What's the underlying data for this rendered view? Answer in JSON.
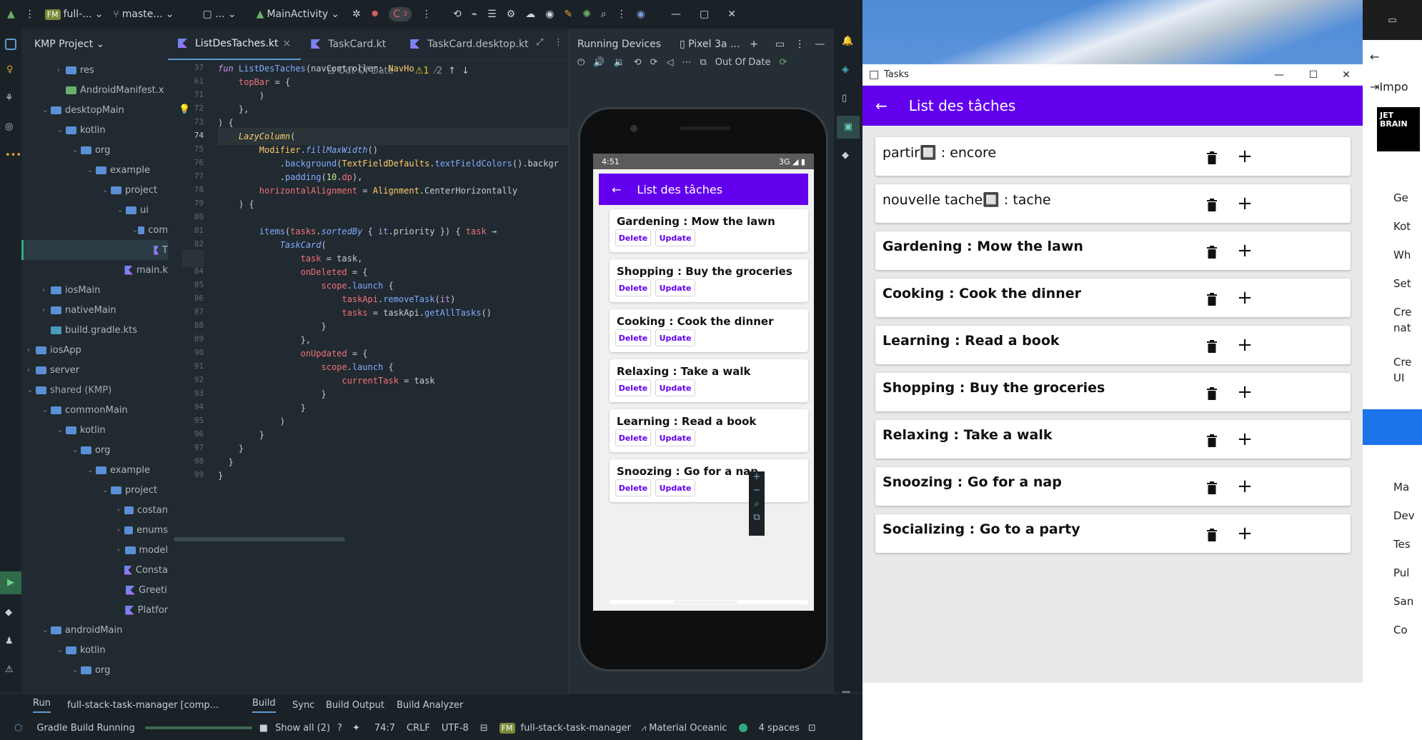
{
  "ide": {
    "project_badge": "FM",
    "project_name": "full-...",
    "branch": "maste...",
    "run_config": "MainActivity",
    "run_count": "3",
    "project_panel_title": "KMP Project",
    "tree": [
      {
        "label": "res",
        "type": "folder",
        "indent": 2,
        "arrow": "›"
      },
      {
        "label": "AndroidManifest.x",
        "type": "android",
        "indent": 2,
        "arrow": ""
      },
      {
        "label": "desktopMain",
        "type": "folder",
        "indent": 1,
        "arrow": "⌄"
      },
      {
        "label": "kotlin",
        "type": "folder",
        "indent": 2,
        "arrow": "⌄"
      },
      {
        "label": "org",
        "type": "folder",
        "indent": 3,
        "arrow": "⌄"
      },
      {
        "label": "example",
        "type": "folder",
        "indent": 4,
        "arrow": "⌄"
      },
      {
        "label": "project",
        "type": "folder",
        "indent": 5,
        "arrow": "⌄"
      },
      {
        "label": "ui",
        "type": "folder",
        "indent": 6,
        "arrow": "⌄"
      },
      {
        "label": "com",
        "type": "folder",
        "indent": 7,
        "arrow": "⌄"
      },
      {
        "label": "T",
        "type": "kotlin",
        "indent": 8,
        "arrow": "",
        "selected": true
      },
      {
        "label": "main.k",
        "type": "kotlin",
        "indent": 6,
        "arrow": ""
      },
      {
        "label": "iosMain",
        "type": "folder",
        "indent": 1,
        "arrow": "›"
      },
      {
        "label": "nativeMain",
        "type": "folder",
        "indent": 1,
        "arrow": "›"
      },
      {
        "label": "build.gradle.kts",
        "type": "gradle",
        "indent": 1,
        "arrow": ""
      },
      {
        "label": "iosApp",
        "type": "folder",
        "indent": 0,
        "arrow": "›"
      },
      {
        "label": "server",
        "type": "folder",
        "indent": 0,
        "arrow": "›"
      },
      {
        "label": "shared (KMP)",
        "type": "folder",
        "indent": 0,
        "arrow": "⌄"
      },
      {
        "label": "commonMain",
        "type": "folder",
        "indent": 1,
        "arrow": "⌄"
      },
      {
        "label": "kotlin",
        "type": "folder",
        "indent": 2,
        "arrow": "⌄"
      },
      {
        "label": "org",
        "type": "folder",
        "indent": 3,
        "arrow": "⌄"
      },
      {
        "label": "example",
        "type": "folder",
        "indent": 4,
        "arrow": "⌄"
      },
      {
        "label": "project",
        "type": "folder",
        "indent": 5,
        "arrow": "⌄"
      },
      {
        "label": "costan",
        "type": "folder",
        "indent": 6,
        "arrow": "›"
      },
      {
        "label": "enums",
        "type": "folder",
        "indent": 6,
        "arrow": "›"
      },
      {
        "label": "model",
        "type": "folder",
        "indent": 6,
        "arrow": "›"
      },
      {
        "label": "Consta",
        "type": "kotlin",
        "indent": 6,
        "arrow": ""
      },
      {
        "label": "Greeti",
        "type": "kotlin",
        "indent": 6,
        "arrow": ""
      },
      {
        "label": "Platfor",
        "type": "kotlin",
        "indent": 6,
        "arrow": ""
      },
      {
        "label": "androidMain",
        "type": "folder",
        "indent": 1,
        "arrow": "⌄"
      },
      {
        "label": "kotlin",
        "type": "folder",
        "indent": 2,
        "arrow": "⌄"
      },
      {
        "label": "org",
        "type": "folder",
        "indent": 3,
        "arrow": "⌄"
      }
    ],
    "tabs": [
      {
        "label": "ListDesTaches.kt",
        "active": true,
        "close": "×"
      },
      {
        "label": "TaskCard.kt",
        "active": false,
        "close": ""
      },
      {
        "label": "TaskCard.desktop.kt",
        "active": false,
        "close": ""
      }
    ],
    "breadcrumb": "fun ListDesTaches(navController: NavHos",
    "out_of_date": "Out Of Date",
    "warnings": "1",
    "weak_warnings": "2",
    "code_lines": [
      {
        "n": "37",
        "html": "<span class='kw it2'>fun </span><span class='fn'>ListDesTaches</span><span class='pl'>(navController: </span><span class='ty'>NavHo</span>"
      },
      {
        "n": "61",
        "html": "    <span class='pr'>topBar</span><span class='pl'> = {</span>"
      },
      {
        "n": "71",
        "html": "        <span class='pl'>)</span>"
      },
      {
        "n": "72",
        "html": "    <span class='pl'>},</span>"
      },
      {
        "n": "73",
        "html": "<span class='pl'>) {</span>"
      },
      {
        "n": "74",
        "html": "    <span class='ty it2'>LazyColumn</span><span class='pl'>(</span>"
      },
      {
        "n": "75",
        "html": "        <span class='ty'>Modifier</span><span class='pl'>.</span><span class='fn it2'>fillMaxWidth</span><span class='pl'>()</span>"
      },
      {
        "n": "76",
        "html": "            <span class='pl'>.</span><span class='fn'>background</span><span class='pl'>(</span><span class='ty'>TextFieldDefaults</span><span class='pl'>.</span><span class='fn'>textFieldColors</span><span class='pl'>().backgr</span>"
      },
      {
        "n": "77",
        "html": "            <span class='pl'>.</span><span class='fn'>padding</span><span class='pl'>(</span><span class='st'>10</span><span class='pl'>.</span><span class='pr'>dp</span><span class='pl'>),</span>"
      },
      {
        "n": "78",
        "html": "        <span class='pr'>horizontalAlignment</span><span class='pl'> = </span><span class='ty'>Alignment</span><span class='pl'>.CenterHorizontally</span>"
      },
      {
        "n": "79",
        "html": "    <span class='pl'>) {</span>"
      },
      {
        "n": "80",
        "html": ""
      },
      {
        "n": "81",
        "html": "        <span class='fn'>items</span><span class='pl'>(</span><span class='pr'>tasks</span><span class='pl'>.</span><span class='fn it2'>sortedBy</span><span class='pl'> { </span><span class='kw'>it</span><span class='pl'>.priority }) { </span><span class='pr'>task</span><span class='pl'> →</span>"
      },
      {
        "n": "82",
        "html": "            <span class='fn it2'>TaskCard</span><span class='pl'>(</span>"
      },
      {
        "n": "83",
        "html": "                <span class='pr'>task</span><span class='pl'> = task,</span>"
      },
      {
        "n": "84",
        "html": "                <span class='pr'>onDeleted</span><span class='pl'> = {</span>"
      },
      {
        "n": "85",
        "html": "                    <span class='pr'>scope</span><span class='pl'>.</span><span class='fn'>launch</span><span class='pl'> {</span>"
      },
      {
        "n": "86",
        "html": "                        <span class='pr'>taskApi</span><span class='pl'>.</span><span class='fn'>removeTask</span><span class='pl'>(</span><span class='kw'>it</span><span class='pl'>)</span>"
      },
      {
        "n": "87",
        "html": "                        <span class='pr'>tasks</span><span class='pl'> = taskApi.</span><span class='fn'>getAllTasks</span><span class='pl'>()</span>"
      },
      {
        "n": "88",
        "html": "                    <span class='pl'>}</span>"
      },
      {
        "n": "89",
        "html": "                <span class='pl'>},</span>"
      },
      {
        "n": "90",
        "html": "                <span class='pr'>onUpdated</span><span class='pl'> = {</span>"
      },
      {
        "n": "91",
        "html": "                    <span class='pr'>scope</span><span class='pl'>.</span><span class='fn'>launch</span><span class='pl'> {</span>"
      },
      {
        "n": "92",
        "html": "                        <span class='pr'>currentTask</span><span class='pl'> = task</span>"
      },
      {
        "n": "93",
        "html": "                    <span class='pl'>}</span>"
      },
      {
        "n": "94",
        "html": "                <span class='pl'>}</span>"
      },
      {
        "n": "95",
        "html": "            <span class='pl'>)</span>"
      },
      {
        "n": "96",
        "html": "        <span class='pl'>}</span>"
      },
      {
        "n": "97",
        "html": "    <span class='pl'>}</span>"
      },
      {
        "n": "98",
        "html": "<span class='pl'>  }</span>"
      },
      {
        "n": "99",
        "html": "<span class='pl'>}</span>"
      }
    ],
    "devices_title": "Running Devices",
    "device_tab": "Pixel 3a ...",
    "device_out_of_date": "Out Of Date",
    "bottom_tabs": [
      "Run",
      "full-stack-task-manager [comp...",
      "Build",
      "Sync",
      "Build Output",
      "Build Analyzer"
    ],
    "status": {
      "task": "Gradle Build Running",
      "show_all": "Show all (2)",
      "position": "74:7",
      "line_sep": "CRLF",
      "encoding": "UTF-8",
      "badge": "FM",
      "project": "full-stack-task-manager",
      "theme": "Material Oceanic",
      "indent": "4 spaces"
    }
  },
  "phone": {
    "time": "4:51",
    "network": "3G",
    "title": "List des tâches",
    "delete_label": "Delete",
    "update_label": "Update",
    "cards": [
      "Gardening : Mow the lawn",
      "Shopping : Buy the groceries",
      "Cooking : Cook the dinner",
      "Relaxing : Take a walk",
      "Learning : Read a book",
      "Snoozing : Go for a nap"
    ]
  },
  "desktop_app": {
    "window_title": "Tasks",
    "title": "List des tâches",
    "cards": [
      {
        "text": "partir🔲 : encore",
        "bold": false
      },
      {
        "text": "nouvelle tache🔲 : tache",
        "bold": false
      },
      {
        "text": "Gardening : Mow the lawn",
        "bold": true
      },
      {
        "text": "Cooking : Cook the dinner",
        "bold": true
      },
      {
        "text": "Learning : Read a book",
        "bold": true
      },
      {
        "text": "Shopping : Buy the groceries",
        "bold": true
      },
      {
        "text": "Relaxing : Take a walk",
        "bold": true
      },
      {
        "text": "Snoozing : Go for a nap",
        "bold": true
      },
      {
        "text": "Socializing : Go to a party",
        "bold": true
      }
    ]
  },
  "browser_edge": {
    "import_label": "Impo",
    "logo": "JET BRAIN",
    "rows": [
      "Ge",
      "Kot",
      "Wh",
      "Set",
      "Cre",
      "nat",
      "Cre",
      "UI",
      "Ma",
      "Dev",
      "Tes",
      "Pul",
      "San",
      "Co"
    ]
  },
  "colors": {
    "accent": "#6200ee",
    "ide_bg": "#212a30",
    "ide_dark": "#1b2227"
  }
}
